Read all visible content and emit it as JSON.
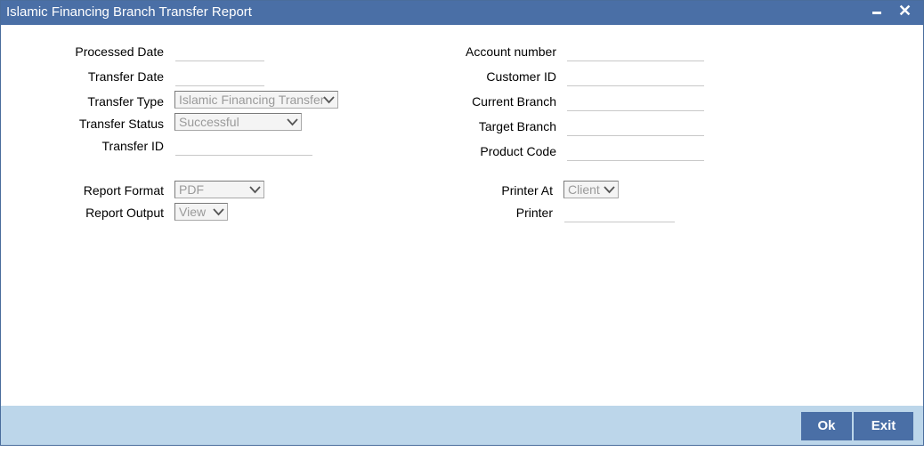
{
  "window": {
    "title": "Islamic Financing Branch Transfer Report",
    "minimize_icon": "minimize-icon",
    "close_icon": "close-icon",
    "close_glyph": "✕"
  },
  "left_form": {
    "processed_date_label": "Processed Date",
    "processed_date_value": "",
    "transfer_date_label": "Transfer Date",
    "transfer_date_value": "",
    "transfer_type_label": "Transfer Type",
    "transfer_type_value": "Islamic Financing Transfer",
    "transfer_status_label": "Transfer Status",
    "transfer_status_value": "Successful",
    "transfer_id_label": "Transfer ID",
    "transfer_id_value": "",
    "report_format_label": "Report Format",
    "report_format_value": "PDF",
    "report_output_label": "Report Output",
    "report_output_value": "View"
  },
  "right_form": {
    "account_number_label": "Account number",
    "account_number_value": "",
    "customer_id_label": "Customer ID",
    "customer_id_value": "",
    "current_branch_label": "Current Branch",
    "current_branch_value": "",
    "target_branch_label": "Target Branch",
    "target_branch_value": "",
    "product_code_label": "Product Code",
    "product_code_value": "",
    "printer_at_label": "Printer At",
    "printer_at_value": "Client",
    "printer_label": "Printer",
    "printer_value": ""
  },
  "footer": {
    "ok_label": "Ok",
    "exit_label": "Exit"
  },
  "colors": {
    "titlebar": "#4a6fa6",
    "footer": "#bcd6ea",
    "button": "#4a6fa6"
  }
}
